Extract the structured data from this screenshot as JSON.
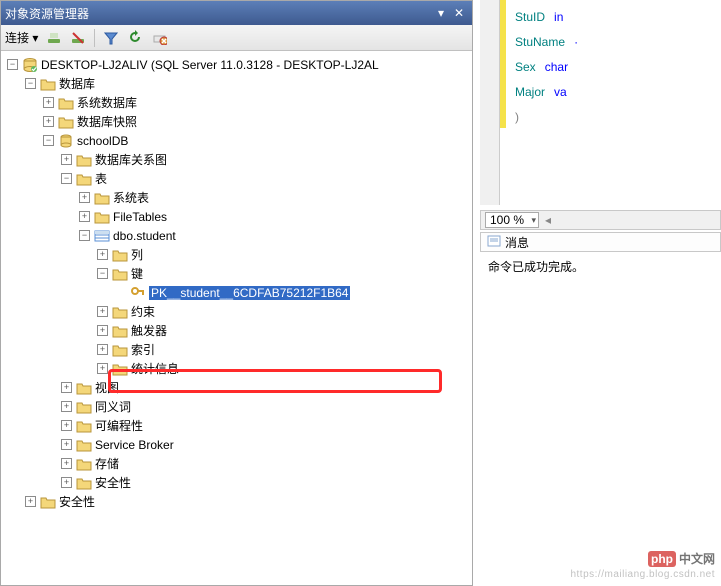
{
  "panel": {
    "title": "对象资源管理器",
    "connect_label": "连接 ▾"
  },
  "tree": {
    "server": "DESKTOP-LJ2ALIV (SQL Server 11.0.3128 - DESKTOP-LJ2AL",
    "databases": "数据库",
    "sysdb": "系统数据库",
    "snapshot": "数据库快照",
    "schooldb": "schoolDB",
    "diagrams": "数据库关系图",
    "tables": "表",
    "systables": "系统表",
    "filetables": "FileTables",
    "dbostudent": "dbo.student",
    "columns": "列",
    "keys": "键",
    "pk": "PK__student__6CDFAB75212F1B64",
    "constraints": "约束",
    "triggers": "触发器",
    "indexes": "索引",
    "stats": "统计信息",
    "views": "视图",
    "synonyms": "同义词",
    "programmability": "可编程性",
    "servicebroker": "Service Broker",
    "storage": "存储",
    "security": "安全性",
    "security2": "安全性"
  },
  "editor": {
    "line1_id": "StuID",
    "line1_kw": "in",
    "line2_id": "StuName",
    "line3_id": "Sex",
    "line3_kw": "char",
    "line4_id": "Major",
    "line4_kw": "va",
    "paren": ")"
  },
  "zoom": "100 %",
  "messages": {
    "tab": "消息",
    "body": "命令已成功完成。"
  },
  "watermark": {
    "php": "php",
    "cn": "中文网",
    "csdn": "https://mailiang.blog.csdn.net"
  }
}
